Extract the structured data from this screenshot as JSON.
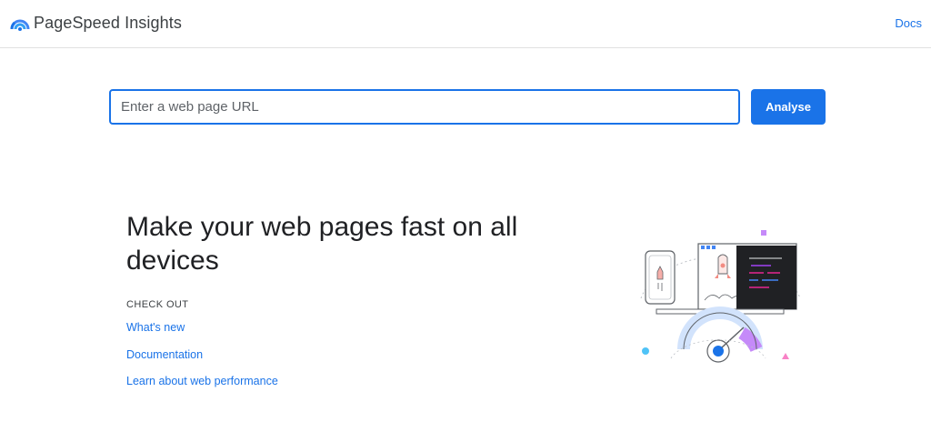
{
  "header": {
    "brand": "PageSpeed Insights",
    "docs_link": "Docs",
    "logo_icon": "pagespeed-logo-icon"
  },
  "search": {
    "placeholder": "Enter a web page URL",
    "value": "",
    "button_label": "Analyse"
  },
  "hero": {
    "title": "Make your web pages fast on all devices",
    "check_out_label": "CHECK OUT",
    "links": [
      {
        "label": "What's new"
      },
      {
        "label": "Documentation"
      },
      {
        "label": "Learn about web performance"
      }
    ],
    "illustration_icon": "devices-speed-illustration"
  },
  "colors": {
    "accent": "#1a73e8",
    "text": "#202124",
    "divider": "#e0e0e0",
    "purple": "#a142f4",
    "pink": "#e52592",
    "light_blue": "#4fc3f7"
  }
}
